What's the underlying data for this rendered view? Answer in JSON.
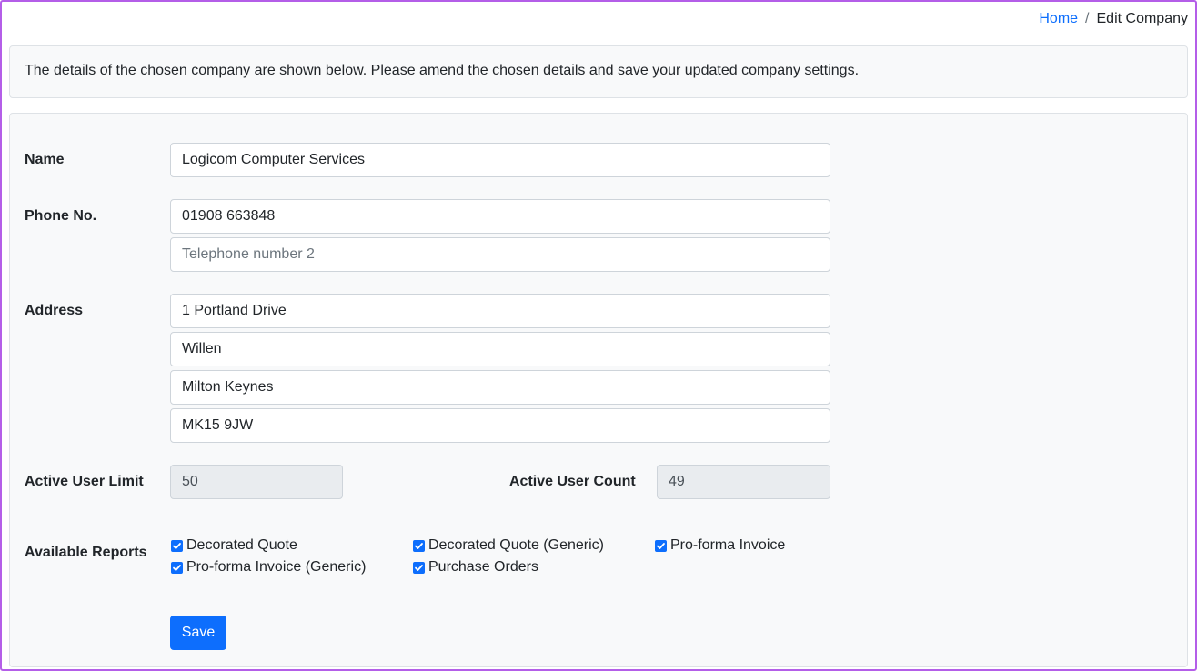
{
  "breadcrumb": {
    "home": "Home",
    "separator": "/",
    "current": "Edit Company"
  },
  "info_text": "The details of the chosen company are shown below. Please amend the chosen details and save your updated company settings.",
  "form": {
    "name": {
      "label": "Name",
      "value": "Logicom Computer Services"
    },
    "phone": {
      "label": "Phone No.",
      "phone1_value": "01908 663848",
      "phone2_value": "",
      "phone2_placeholder": "Telephone number 2"
    },
    "address": {
      "label": "Address",
      "line1": "1 Portland Drive",
      "line2": "Willen",
      "line3": "Milton Keynes",
      "line4": "MK15 9JW"
    },
    "active_user_limit": {
      "label": "Active User Limit",
      "value": "50"
    },
    "active_user_count": {
      "label": "Active User Count",
      "value": "49"
    },
    "reports": {
      "label": "Available Reports",
      "items": [
        {
          "label": "Decorated Quote",
          "checked": true
        },
        {
          "label": "Decorated Quote (Generic)",
          "checked": true
        },
        {
          "label": "Pro-forma Invoice",
          "checked": true
        },
        {
          "label": "Pro-forma Invoice (Generic)",
          "checked": true
        },
        {
          "label": "Purchase Orders",
          "checked": true
        }
      ]
    },
    "save_label": "Save"
  },
  "colors": {
    "accent": "#0d6efd",
    "frame": "#b45ee8",
    "panel_bg": "#f8f9fa"
  }
}
